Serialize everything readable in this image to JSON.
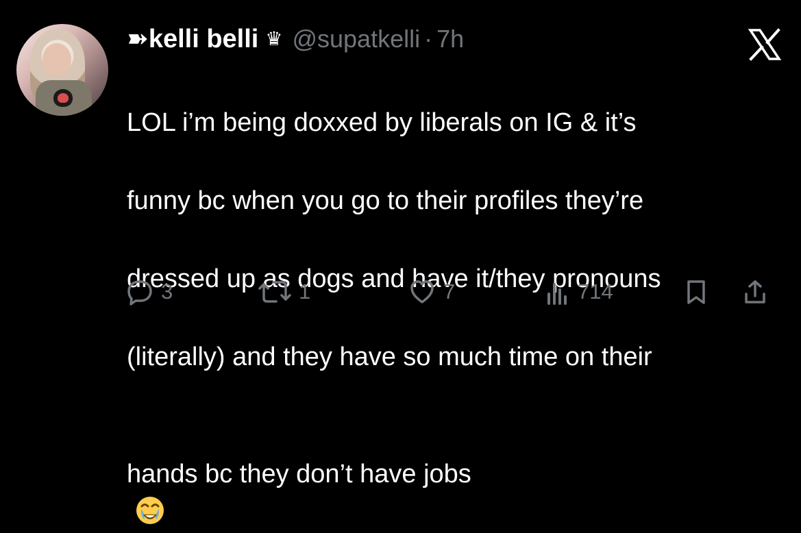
{
  "tweet": {
    "author": {
      "display_name": "➽kelli belli",
      "badge": "♛",
      "handle": "@supatkelli",
      "separator": "·",
      "time": "7h"
    },
    "text_lines": [
      "LOL i’m being doxxed by liberals on IG & it’s",
      "funny bc when you go to their profiles they’re",
      "dressed up as dogs and have it/they pronouns",
      "(literally) and they have so much time on their",
      "hands bc they don’t have jobs"
    ],
    "emoji": "crying-face-emoji",
    "stats": {
      "replies": "3",
      "reposts": "1",
      "likes": "7",
      "views": "714"
    },
    "icons": {
      "reply": "reply-icon",
      "repost": "repost-icon",
      "like": "heart-icon",
      "views": "views-icon",
      "bookmark": "bookmark-icon",
      "share": "share-icon",
      "platform": "x-logo-icon"
    },
    "colors": {
      "background": "#000000",
      "text": "#ffffff",
      "secondary": "#71767b"
    }
  }
}
